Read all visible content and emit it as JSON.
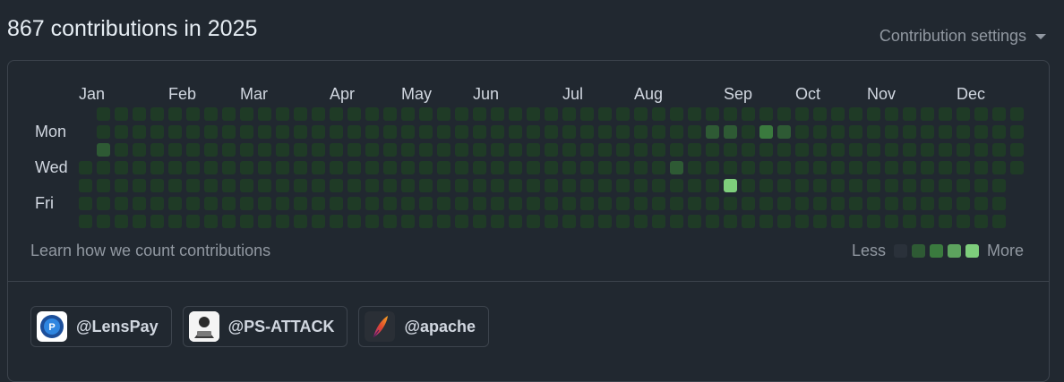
{
  "header": {
    "title": "867 contributions in 2025",
    "settings_label": "Contribution settings"
  },
  "graph": {
    "months": [
      "Jan",
      "Feb",
      "Mar",
      "Apr",
      "May",
      "Jun",
      "Jul",
      "Aug",
      "Sep",
      "Oct",
      "Nov",
      "Dec"
    ],
    "days": [
      "Mon",
      "Wed",
      "Fri"
    ],
    "levels": [
      "0000000000000000000000000000000000000000000000000000",
      "0000000000000000000000000000000000011021000000000000",
      "0100000000000000000000000000000000000000000000000000",
      "0000000000000000000000000000000001000000000000000000",
      "0000000000000000000000000000000000004000000000000000",
      "0000000000000000000000000000000000000000000000000000",
      "0000000000000000000000000000000000000000000000000000"
    ],
    "colors": {
      "0": "#1f3b26",
      "1": "#2e5a34",
      "2": "#3a7a3e",
      "3": "#5da35e",
      "4": "#7ece7c",
      "empty": "#2a313a"
    }
  },
  "footer": {
    "learn_label": "Learn how we count contributions",
    "less_label": "Less",
    "more_label": "More"
  },
  "orgs": [
    {
      "label": "@LensPay",
      "icon": "lenspay-logo"
    },
    {
      "label": "@PS-ATTACK",
      "icon": "ps-attack-avatar"
    },
    {
      "label": "@apache",
      "icon": "apache-feather-logo"
    }
  ]
}
